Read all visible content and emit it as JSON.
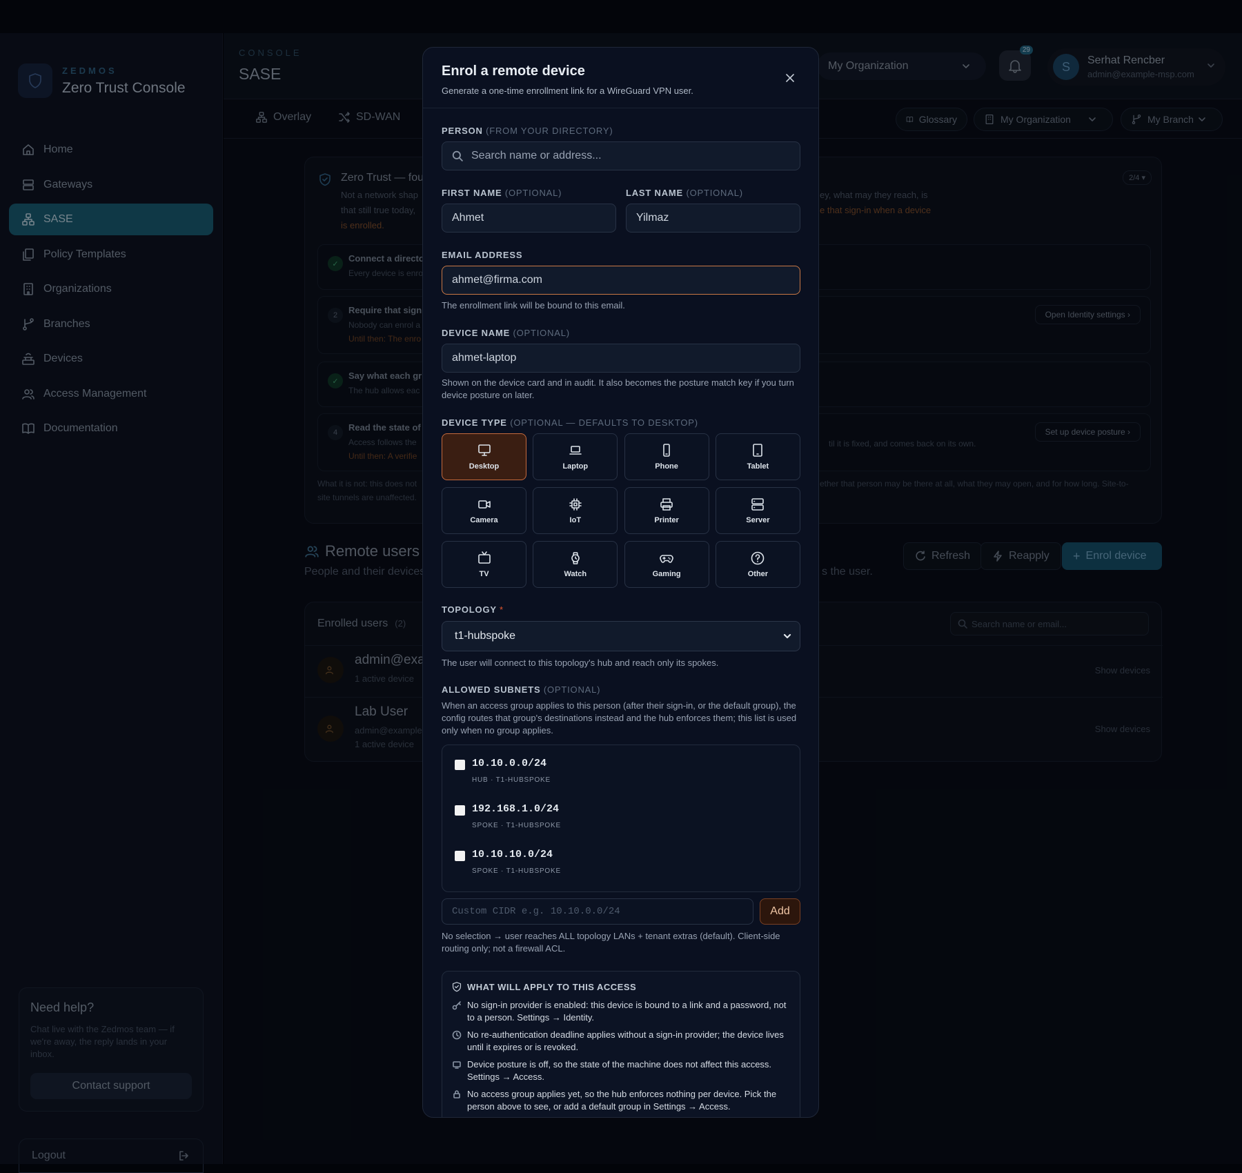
{
  "sidebar": {
    "brand_small": "ZEDMOS",
    "brand_title": "Zero Trust Console",
    "items": [
      {
        "label": "Home",
        "icon": "home-icon"
      },
      {
        "label": "Gateways",
        "icon": "gateways-icon"
      },
      {
        "label": "SASE",
        "icon": "sase-icon",
        "active": true
      },
      {
        "label": "Policy Templates",
        "icon": "templates-icon"
      },
      {
        "label": "Organizations",
        "icon": "building-icon"
      },
      {
        "label": "Branches",
        "icon": "branch-icon"
      },
      {
        "label": "Devices",
        "icon": "devices-icon"
      },
      {
        "label": "Access Management",
        "icon": "users-icon"
      },
      {
        "label": "Documentation",
        "icon": "book-icon"
      }
    ],
    "help": {
      "title": "Need help?",
      "text": "Chat live with the Zedmos team — if we're away, the reply lands in your inbox.",
      "button": "Contact support"
    },
    "logout": "Logout"
  },
  "header": {
    "console_label": "CONSOLE",
    "page_title": "SASE",
    "org_selector": "My Organization",
    "notification_count": "29",
    "user": {
      "initial": "S",
      "name": "Serhat Rencber",
      "email": "admin@example-msp.com"
    }
  },
  "tabs": [
    {
      "label": "Overlay",
      "icon": "overlay-icon"
    },
    {
      "label": "SD-WAN",
      "icon": "shuffle-icon"
    }
  ],
  "toolbar": {
    "glossary": "Glossary",
    "org": "My Organization",
    "branch": "My Branch"
  },
  "zero_trust_card": {
    "title": "Zero Trust — fou",
    "desc_left": [
      "Not a network shap",
      "that still true today,",
      "is enrolled."
    ],
    "desc_right_1": "ey, what may they reach, is",
    "desc_right_2": "e that sign-in when a device",
    "page": "2/4 ▾",
    "steps": [
      {
        "num": "✓",
        "done": true,
        "title": "Connect a directo",
        "sub": "Every device is enro",
        "sub2": ""
      },
      {
        "num": "2",
        "done": false,
        "title": "Require that sign",
        "sub": "Nobody can enrol a",
        "sub2": "Until then: The enro",
        "button": "Open Identity settings"
      },
      {
        "num": "✓",
        "done": true,
        "title": "Say what each gr",
        "sub": "The hub allows eac",
        "sub2": ""
      },
      {
        "num": "4",
        "done": false,
        "title": "Read the state of",
        "sub": "Access follows the",
        "sub2": "Until then: A verifie",
        "button": "Set up device posture",
        "right_text": "til it is fixed, and comes back on its own."
      }
    ],
    "note_left": "What it is not: this does not",
    "note_left2": "site tunnels are unaffected.",
    "note_right": "ether that person may be there at all, what they may open, and for how long. Site-to-"
  },
  "remote_users": {
    "title": "Remote users",
    "subtitle": "People and their devices",
    "subtitle_right": "s the user.",
    "buttons": {
      "refresh": "Refresh",
      "reapply": "Reapply",
      "enrol": "Enrol device"
    },
    "list_title": "Enrolled users",
    "list_count": "(2)",
    "search_placeholder": "Search name or email...",
    "rows": [
      {
        "name": "admin@exa",
        "email": "",
        "devices": "1 active device",
        "action": "Show devices"
      },
      {
        "name": "Lab User",
        "email": "admin@example",
        "devices": "1 active device",
        "action": "Show devices"
      }
    ]
  },
  "modal": {
    "title": "Enrol a remote device",
    "subtitle": "Generate a one-time enrollment link for a WireGuard VPN user.",
    "person_label": "PERSON",
    "person_label_optional": "(FROM YOUR DIRECTORY)",
    "person_placeholder": "Search name or address...",
    "first_name_label": "FIRST NAME",
    "first_name_optional": "(OPTIONAL)",
    "first_name_value": "Ahmet",
    "last_name_label": "LAST NAME",
    "last_name_optional": "(OPTIONAL)",
    "last_name_value": "Yilmaz",
    "email_label": "EMAIL ADDRESS",
    "email_value": "ahmet@firma.com",
    "email_hint": "The enrollment link will be bound to this email.",
    "device_name_label": "DEVICE NAME",
    "device_name_optional": "(OPTIONAL)",
    "device_name_value": "ahmet-laptop",
    "device_name_hint": "Shown on the device card and in audit. It also becomes the posture match key if you turn device posture on later.",
    "device_type_label": "DEVICE TYPE",
    "device_type_optional": "(OPTIONAL — DEFAULTS TO DESKTOP)",
    "device_types": [
      {
        "label": "Desktop",
        "icon": "desktop-icon",
        "selected": true
      },
      {
        "label": "Laptop",
        "icon": "laptop-icon"
      },
      {
        "label": "Phone",
        "icon": "phone-icon"
      },
      {
        "label": "Tablet",
        "icon": "tablet-icon"
      },
      {
        "label": "Camera",
        "icon": "camera-icon"
      },
      {
        "label": "IoT",
        "icon": "chip-icon"
      },
      {
        "label": "Printer",
        "icon": "printer-icon"
      },
      {
        "label": "Server",
        "icon": "server-icon"
      },
      {
        "label": "TV",
        "icon": "tv-icon"
      },
      {
        "label": "Watch",
        "icon": "watch-icon"
      },
      {
        "label": "Gaming",
        "icon": "gamepad-icon"
      },
      {
        "label": "Other",
        "icon": "help-circle-icon"
      }
    ],
    "topology_label": "TOPOLOGY",
    "topology_required": "*",
    "topology_value": "t1-hubspoke",
    "topology_hint": "The user will connect to this topology's hub and reach only its spokes.",
    "subnets_label": "ALLOWED SUBNETS",
    "subnets_optional": "(OPTIONAL)",
    "subnets_hint": "When an access group applies to this person (after their sign-in, or the default group), the config routes that group's destinations instead and the hub enforces them; this list is used only when no group applies.",
    "subnets": [
      {
        "cidr": "10.10.0.0/24",
        "meta": "HUB · T1-HUBSPOKE"
      },
      {
        "cidr": "192.168.1.0/24",
        "meta": "SPOKE · T1-HUBSPOKE"
      },
      {
        "cidr": "10.10.10.0/24",
        "meta": "SPOKE · T1-HUBSPOKE"
      }
    ],
    "custom_cidr_placeholder": "Custom CIDR e.g. 10.10.0.0/24",
    "add_button": "Add",
    "routing_hint": "No selection → user reaches ALL topology LANs + tenant extras (default). Client-side routing only; not a firewall ACL.",
    "apply_title": "WHAT WILL APPLY TO THIS ACCESS",
    "apply_items": [
      {
        "icon": "key-icon",
        "text": "No sign-in provider is enabled: this device is bound to a link and a password, not to a person. Settings → Identity."
      },
      {
        "icon": "clock-icon",
        "text": "No re-authentication deadline applies without a sign-in provider; the device lives until it expires or is revoked."
      },
      {
        "icon": "monitor-icon",
        "text": "Device posture is off, so the state of the machine does not affect this access. Settings → Access."
      },
      {
        "icon": "lock-icon",
        "text": "No access group applies yet, so the hub enforces nothing per device. Pick the person above to see, or add a default group in Settings → Access."
      }
    ]
  },
  "colors": {
    "accent": "#17566c",
    "selected_device": "#3a1e12",
    "focus_border": "#c97845",
    "enrol_button": "#1b5b78"
  }
}
